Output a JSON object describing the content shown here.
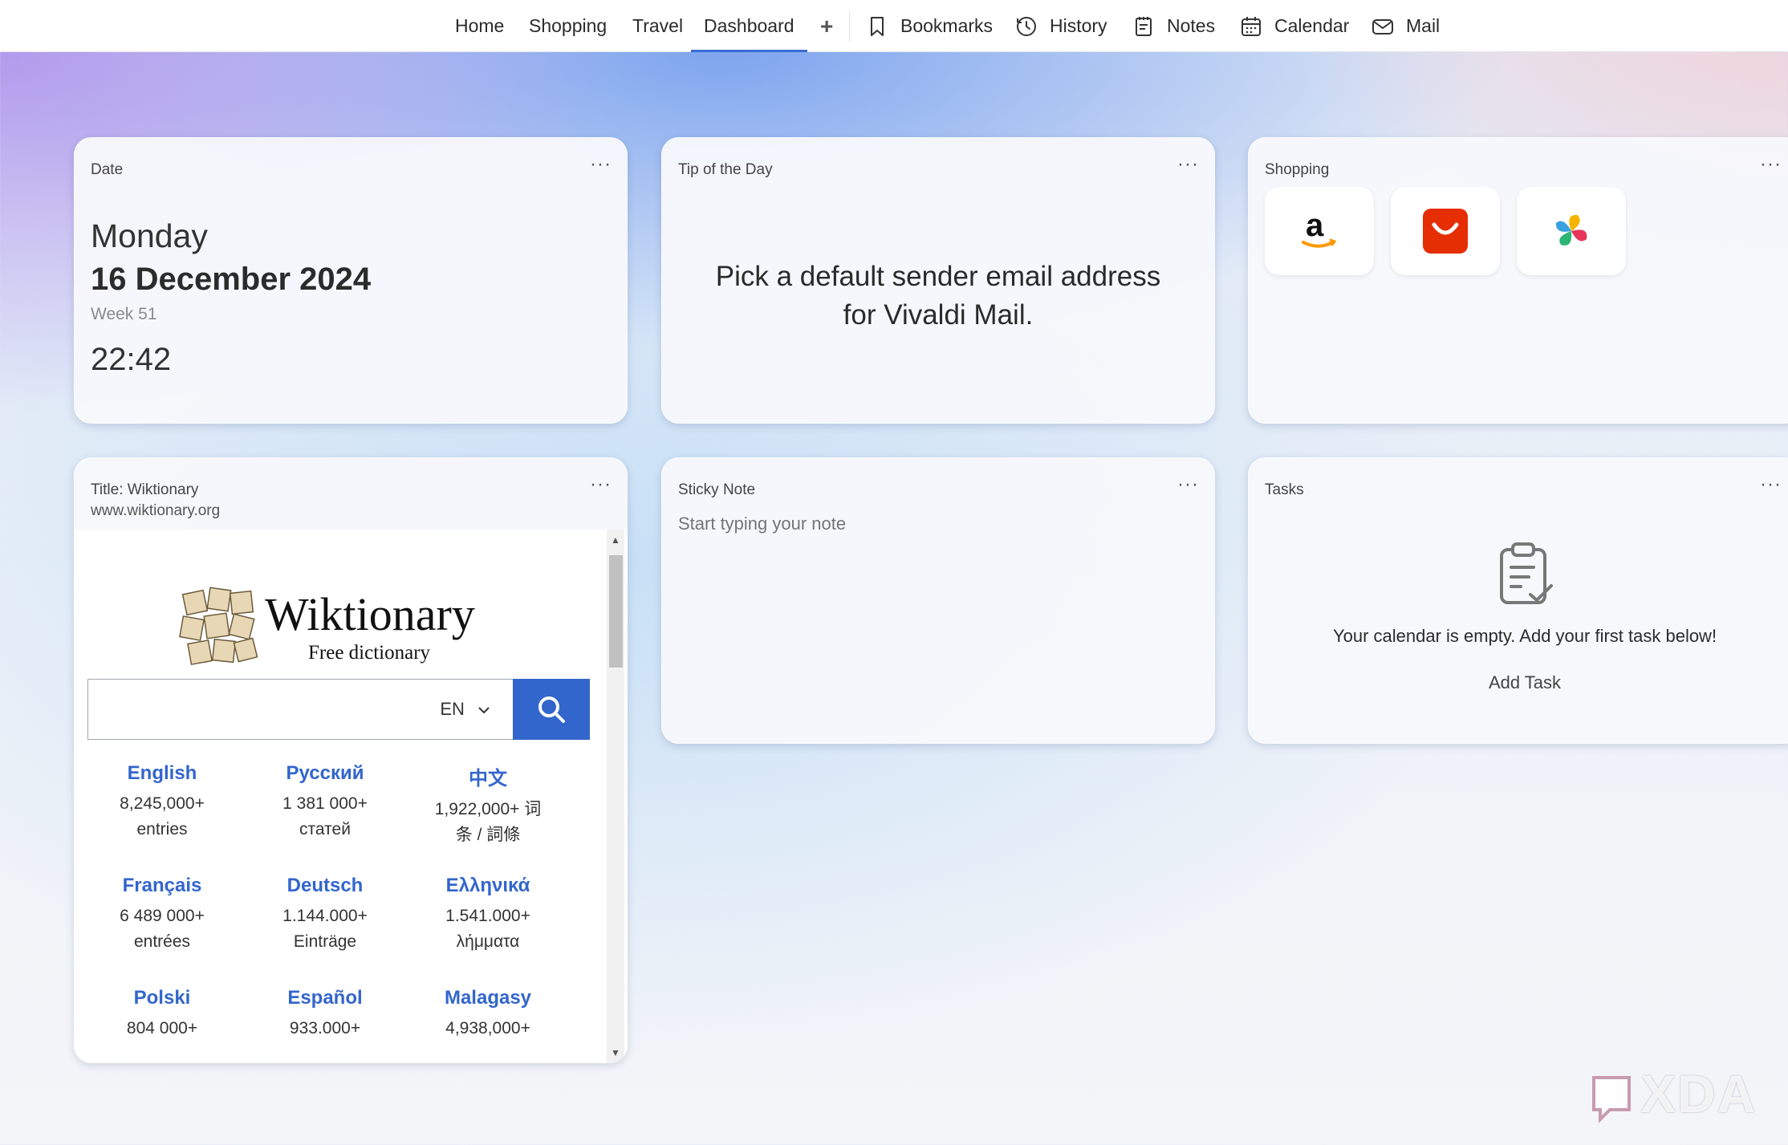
{
  "nav": {
    "tabs": [
      {
        "label": "Home"
      },
      {
        "label": "Shopping"
      },
      {
        "label": "Travel"
      },
      {
        "label": "Dashboard",
        "active": true
      }
    ],
    "add_symbol": "+",
    "panels": [
      {
        "label": "Bookmarks",
        "icon": "bookmark-icon"
      },
      {
        "label": "History",
        "icon": "history-icon"
      },
      {
        "label": "Notes",
        "icon": "notes-icon"
      },
      {
        "label": "Calendar",
        "icon": "calendar-icon"
      },
      {
        "label": "Mail",
        "icon": "mail-icon"
      }
    ]
  },
  "widgets": {
    "date": {
      "title": "Date",
      "menu": "···",
      "day": "Monday",
      "date": "16 December 2024",
      "week": "Week 51",
      "time": "22:42"
    },
    "tip": {
      "title": "Tip of the Day",
      "menu": "···",
      "text": "Pick a default sender email address for Vivaldi Mail."
    },
    "shopping": {
      "title": "Shopping",
      "menu": "···",
      "tiles": [
        "amazon-logo",
        "aliexpress-logo",
        "pinwheel-logo"
      ],
      "amazon_letter": "a"
    },
    "wiktionary": {
      "title": "Title: Wiktionary",
      "url": "www.wiktionary.org",
      "menu": "···",
      "site_name": "Wiktionary",
      "tagline": "Free dictionary",
      "search_lang": "EN",
      "languages": [
        {
          "name": "English",
          "line1": "8,245,000+",
          "line2": "entries"
        },
        {
          "name": "Русский",
          "line1": "1 381 000+",
          "line2": "статей"
        },
        {
          "name": "中文",
          "line1": "1,922,000+ 词",
          "line2": "条 / 詞條"
        },
        {
          "name": "Français",
          "line1": "6 489 000+",
          "line2": "entrées"
        },
        {
          "name": "Deutsch",
          "line1": "1.144.000+",
          "line2": "Einträge"
        },
        {
          "name": "Ελληνικά",
          "line1": "1.541.000+",
          "line2": "λήμματα"
        },
        {
          "name": "Polski",
          "line1": "804 000+",
          "line2": ""
        },
        {
          "name": "Español",
          "line1": "933.000+",
          "line2": ""
        },
        {
          "name": "Malagasy",
          "line1": "4,938,000+",
          "line2": ""
        }
      ]
    },
    "sticky": {
      "title": "Sticky Note",
      "menu": "···",
      "placeholder": "Start typing your note"
    },
    "tasks": {
      "title": "Tasks",
      "menu": "···",
      "empty_text": "Your calendar is empty. Add your first task below!",
      "add_label": "Add Task"
    }
  },
  "watermark": "XDA",
  "colors": {
    "accent": "#3a6bd6",
    "wiki_blue": "#3366cc",
    "aliexpress": "#e62e04",
    "amazon_smile": "#ff9900"
  }
}
